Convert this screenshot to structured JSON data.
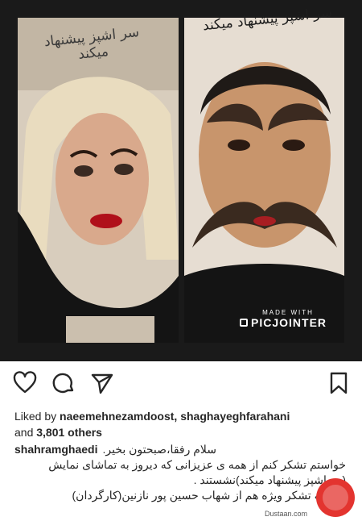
{
  "post_image": {
    "caption_left": "سر اشپز پیشنهاد میکند",
    "caption_right": "سر اشپز پیشنهاد میکند",
    "watermark_top": "MADE WITH",
    "watermark_brand": "PICJOINTER"
  },
  "actions": {
    "like_icon": "heart-icon",
    "comment_icon": "comment-icon",
    "share_icon": "send-icon",
    "save_icon": "bookmark-icon"
  },
  "likes": {
    "prefix": "Liked by",
    "users": "naeemehnezamdoost, shaghayeghfarahani",
    "and": "and",
    "others": "3,801 others"
  },
  "caption": {
    "username": "shahramghaedi",
    "line1": "سلام رفقا،صبحتون بخیر.",
    "line2": "خواستم تشکر کنم از همه ی عزیزانی که دیروز به تماشای نمایش",
    "line3": "(سراشپز پیشنهاد میکند)نشستند .",
    "line4": "البته به تشکر ویژه هم از شهاب حسین پور نازنین(کارگردان)"
  },
  "logo": {
    "site": "Dustaan.com"
  },
  "colors": {
    "text": "#262626",
    "media_border": "#1a1a1a",
    "logo_red": "#e3342f"
  }
}
